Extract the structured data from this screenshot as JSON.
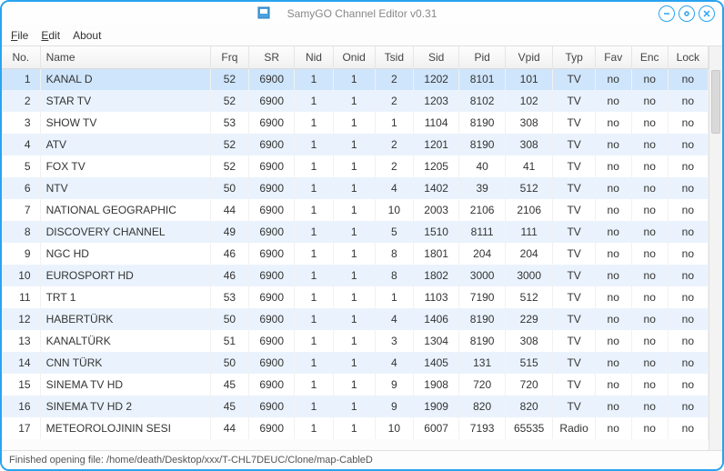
{
  "window": {
    "title": "SamyGO Channel Editor v0.31"
  },
  "menu": {
    "file": "File",
    "edit": "Edit",
    "about": "About"
  },
  "columns": [
    "No.",
    "Name",
    "Frq",
    "SR",
    "Nid",
    "Onid",
    "Tsid",
    "Sid",
    "Pid",
    "Vpid",
    "Typ",
    "Fav",
    "Enc",
    "Lock"
  ],
  "rows": [
    {
      "no": 1,
      "name": "KANAL D",
      "frq": 52,
      "sr": 6900,
      "nid": 1,
      "onid": 1,
      "tsid": 2,
      "sid": 1202,
      "pid": 8101,
      "vpid": 101,
      "typ": "TV",
      "fav": "no",
      "enc": "no",
      "lock": "no",
      "sel": true
    },
    {
      "no": 2,
      "name": "STAR TV",
      "frq": 52,
      "sr": 6900,
      "nid": 1,
      "onid": 1,
      "tsid": 2,
      "sid": 1203,
      "pid": 8102,
      "vpid": 102,
      "typ": "TV",
      "fav": "no",
      "enc": "no",
      "lock": "no"
    },
    {
      "no": 3,
      "name": "SHOW TV",
      "frq": 53,
      "sr": 6900,
      "nid": 1,
      "onid": 1,
      "tsid": 1,
      "sid": 1104,
      "pid": 8190,
      "vpid": 308,
      "typ": "TV",
      "fav": "no",
      "enc": "no",
      "lock": "no"
    },
    {
      "no": 4,
      "name": "ATV",
      "frq": 52,
      "sr": 6900,
      "nid": 1,
      "onid": 1,
      "tsid": 2,
      "sid": 1201,
      "pid": 8190,
      "vpid": 308,
      "typ": "TV",
      "fav": "no",
      "enc": "no",
      "lock": "no"
    },
    {
      "no": 5,
      "name": "FOX TV",
      "frq": 52,
      "sr": 6900,
      "nid": 1,
      "onid": 1,
      "tsid": 2,
      "sid": 1205,
      "pid": 40,
      "vpid": 41,
      "typ": "TV",
      "fav": "no",
      "enc": "no",
      "lock": "no"
    },
    {
      "no": 6,
      "name": "NTV",
      "frq": 50,
      "sr": 6900,
      "nid": 1,
      "onid": 1,
      "tsid": 4,
      "sid": 1402,
      "pid": 39,
      "vpid": 512,
      "typ": "TV",
      "fav": "no",
      "enc": "no",
      "lock": "no"
    },
    {
      "no": 7,
      "name": "NATIONAL GEOGRAPHIC",
      "frq": 44,
      "sr": 6900,
      "nid": 1,
      "onid": 1,
      "tsid": 10,
      "sid": 2003,
      "pid": 2106,
      "vpid": 2106,
      "typ": "TV",
      "fav": "no",
      "enc": "no",
      "lock": "no"
    },
    {
      "no": 8,
      "name": "DISCOVERY CHANNEL",
      "frq": 49,
      "sr": 6900,
      "nid": 1,
      "onid": 1,
      "tsid": 5,
      "sid": 1510,
      "pid": 8111,
      "vpid": 111,
      "typ": "TV",
      "fav": "no",
      "enc": "no",
      "lock": "no"
    },
    {
      "no": 9,
      "name": "NGC HD",
      "frq": 46,
      "sr": 6900,
      "nid": 1,
      "onid": 1,
      "tsid": 8,
      "sid": 1801,
      "pid": 204,
      "vpid": 204,
      "typ": "TV",
      "fav": "no",
      "enc": "no",
      "lock": "no"
    },
    {
      "no": 10,
      "name": "EUROSPORT HD",
      "frq": 46,
      "sr": 6900,
      "nid": 1,
      "onid": 1,
      "tsid": 8,
      "sid": 1802,
      "pid": 3000,
      "vpid": 3000,
      "typ": "TV",
      "fav": "no",
      "enc": "no",
      "lock": "no"
    },
    {
      "no": 11,
      "name": "TRT 1",
      "frq": 53,
      "sr": 6900,
      "nid": 1,
      "onid": 1,
      "tsid": 1,
      "sid": 1103,
      "pid": 7190,
      "vpid": 512,
      "typ": "TV",
      "fav": "no",
      "enc": "no",
      "lock": "no"
    },
    {
      "no": 12,
      "name": "HABERTÜRK",
      "frq": 50,
      "sr": 6900,
      "nid": 1,
      "onid": 1,
      "tsid": 4,
      "sid": 1406,
      "pid": 8190,
      "vpid": 229,
      "typ": "TV",
      "fav": "no",
      "enc": "no",
      "lock": "no"
    },
    {
      "no": 13,
      "name": "KANALTÜRK",
      "frq": 51,
      "sr": 6900,
      "nid": 1,
      "onid": 1,
      "tsid": 3,
      "sid": 1304,
      "pid": 8190,
      "vpid": 308,
      "typ": "TV",
      "fav": "no",
      "enc": "no",
      "lock": "no"
    },
    {
      "no": 14,
      "name": "CNN TÜRK",
      "frq": 50,
      "sr": 6900,
      "nid": 1,
      "onid": 1,
      "tsid": 4,
      "sid": 1405,
      "pid": 131,
      "vpid": 515,
      "typ": "TV",
      "fav": "no",
      "enc": "no",
      "lock": "no"
    },
    {
      "no": 15,
      "name": "SINEMA TV HD",
      "frq": 45,
      "sr": 6900,
      "nid": 1,
      "onid": 1,
      "tsid": 9,
      "sid": 1908,
      "pid": 720,
      "vpid": 720,
      "typ": "TV",
      "fav": "no",
      "enc": "no",
      "lock": "no"
    },
    {
      "no": 16,
      "name": "SINEMA TV HD 2",
      "frq": 45,
      "sr": 6900,
      "nid": 1,
      "onid": 1,
      "tsid": 9,
      "sid": 1909,
      "pid": 820,
      "vpid": 820,
      "typ": "TV",
      "fav": "no",
      "enc": "no",
      "lock": "no"
    },
    {
      "no": 17,
      "name": "METEOROLOJININ SESI",
      "frq": 44,
      "sr": 6900,
      "nid": 1,
      "onid": 1,
      "tsid": 10,
      "sid": 6007,
      "pid": 7193,
      "vpid": 65535,
      "typ": "Radio",
      "fav": "no",
      "enc": "no",
      "lock": "no"
    }
  ],
  "status": "Finished opening file: /home/death/Desktop/xxx/T-CHL7DEUC/Clone/map-CableD"
}
